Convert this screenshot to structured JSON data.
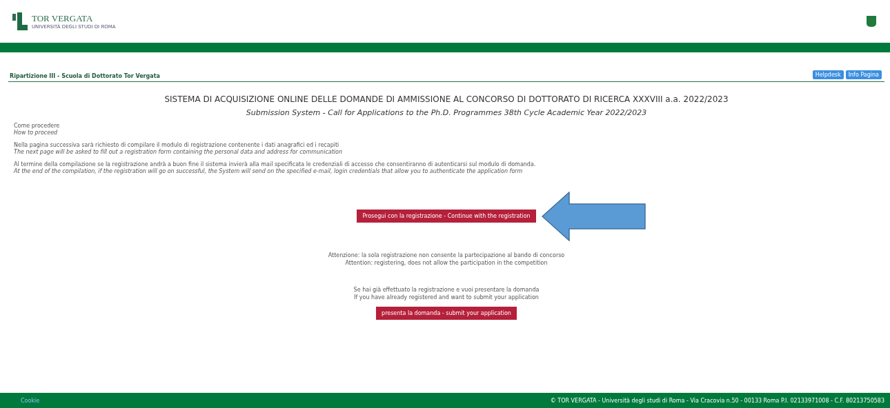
{
  "header": {
    "logo_title": "TOR VERGATA",
    "logo_subtitle": "UNIVERSITÀ DEGLI STUDI DI ROMA"
  },
  "section": {
    "title": "Ripartizione III - Scuola di Dottorato Tor Vergata",
    "buttons": [
      "Helpdesk",
      "Info Pagina"
    ]
  },
  "title": "SISTEMA DI ACQUISIZIONE ONLINE DELLE DOMANDE DI AMMISSIONE AL CONCORSO DI DOTTORATO DI RICERCA XXXVIII a.a. 2022/2023",
  "subtitle": "Submission System - Call for Applications to the Ph.D. Programmes 38th Cycle Academic Year 2022/2023",
  "paragraphs": [
    {
      "it": "Come procedere",
      "en": "How to proceed"
    },
    {
      "it": "Nella pagina successiva sarà richiesto di compilare il modulo di registrazione contenente i dati anagrafici ed i recapiti",
      "en": "The next page will be asked to fill out a registration form containing the personal data and address for communication"
    },
    {
      "it": "Al termine della compilazione se la registrazione andrà a buon fine il sistema invierà alla mail specificata le credenziali di accesso che consentiranno di autenticarsi sul modulo di domanda.",
      "en": "At the end of the compilation, if the registration will go on successful, the System will send on the specified e-mail, login credentials that allow you to authenticate the application form"
    }
  ],
  "register_button": "Prosegui con la registrazione - Continue with the registration",
  "notice": {
    "it": "Attenzione: la sola registrazione non consente la partecipazione al bando di concorso",
    "en": "Attention: registering, does not allow the participation in the competition"
  },
  "already": {
    "it": "Se hai già effettuato la registrazione e vuoi presentare la domanda",
    "en": "If you have already registered and want to submit your application"
  },
  "submit_button": "presenta la domanda - submit your application",
  "footer": {
    "link": "Cookie",
    "copyright": "© TOR VERGATA - Università degli studi di Roma - Via Cracovia n.50 - 00133 Roma P.I. 02133971008 - C.F. 80213750583"
  }
}
